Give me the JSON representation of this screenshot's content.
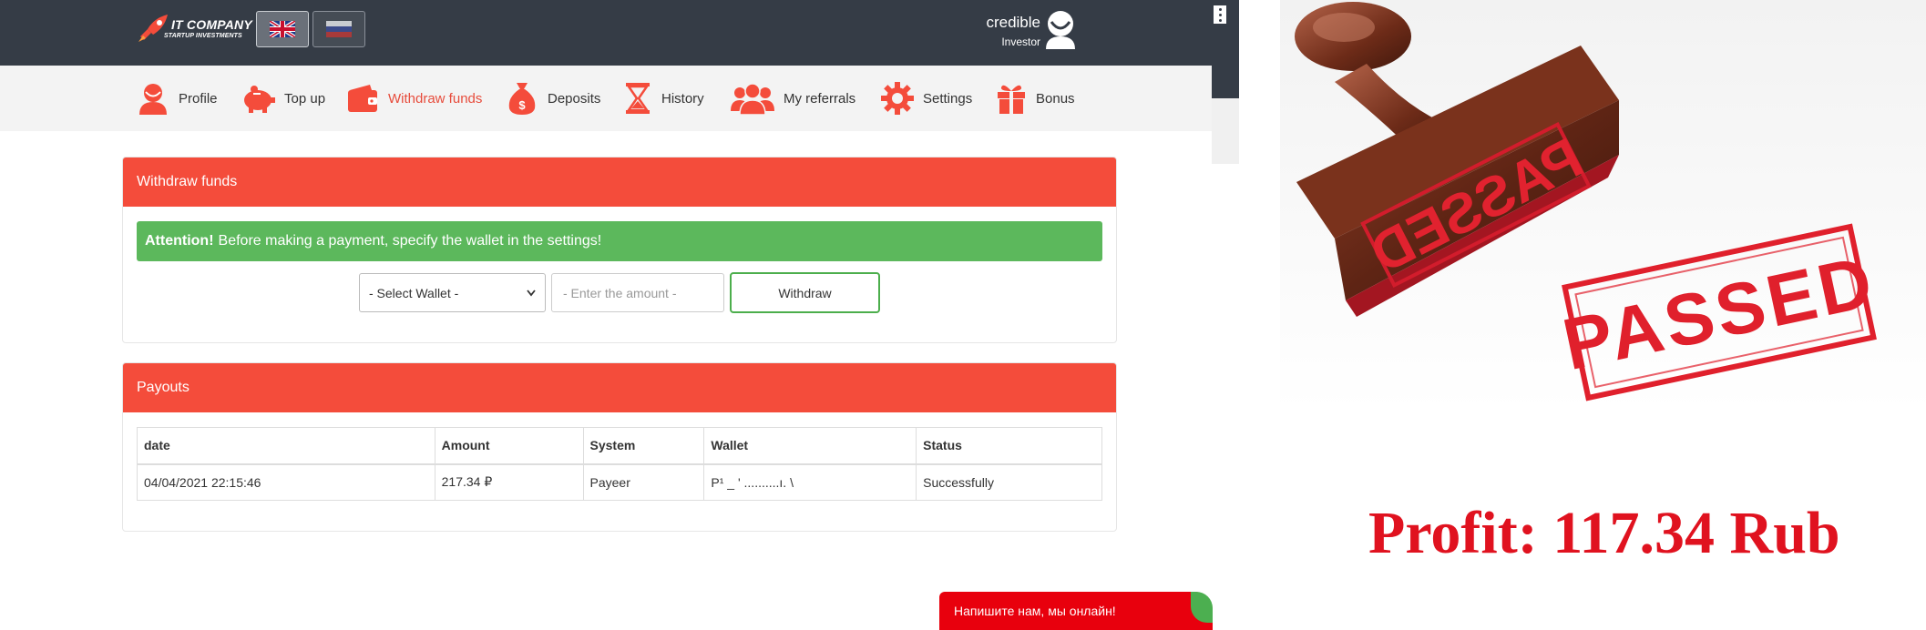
{
  "logo": {
    "name": "IT COMPANY",
    "tagline": "STARTUP INVESTMENTS"
  },
  "user": {
    "name": "credible",
    "role": "Investor"
  },
  "nav": [
    {
      "label": "Profile",
      "icon": "user-icon"
    },
    {
      "label": "Top up",
      "icon": "piggy-bank-icon"
    },
    {
      "label": "Withdraw funds",
      "icon": "wallet-icon",
      "active": true
    },
    {
      "label": "Deposits",
      "icon": "money-bag-icon"
    },
    {
      "label": "History",
      "icon": "hourglass-icon"
    },
    {
      "label": "My referrals",
      "icon": "group-icon"
    },
    {
      "label": "Settings",
      "icon": "gear-icon"
    },
    {
      "label": "Bonus",
      "icon": "gift-icon"
    }
  ],
  "withdraw": {
    "title": "Withdraw funds",
    "alert_strong": "Attention!",
    "alert_text": "Before making a payment, specify the wallet in the settings!",
    "select_label": "- Select Wallet -",
    "amount_placeholder": "- Enter the amount -",
    "button_label": "Withdraw"
  },
  "payouts": {
    "title": "Payouts",
    "columns": [
      "date",
      "Amount",
      "System",
      "Wallet",
      "Status"
    ],
    "rows": [
      {
        "date": "04/04/2021 22:15:46",
        "amount": "217.34 ₽",
        "system": "Payeer",
        "wallet": "P¹ _ ' ..........ı. \\",
        "status": "Successfully"
      }
    ]
  },
  "chat": {
    "label": "Напишите нам, мы онлайн!"
  },
  "promo": {
    "stamp_text": "PASSED",
    "stamp_mirror_text": "PASSED",
    "profit_text": "Profit: 117.34 Rub"
  },
  "colors": {
    "topbar": "#353c46",
    "accent_red": "#f44c3b",
    "alert_green": "#5cb85c",
    "profit_red": "#e0121f",
    "chat_red": "#e8000d"
  }
}
